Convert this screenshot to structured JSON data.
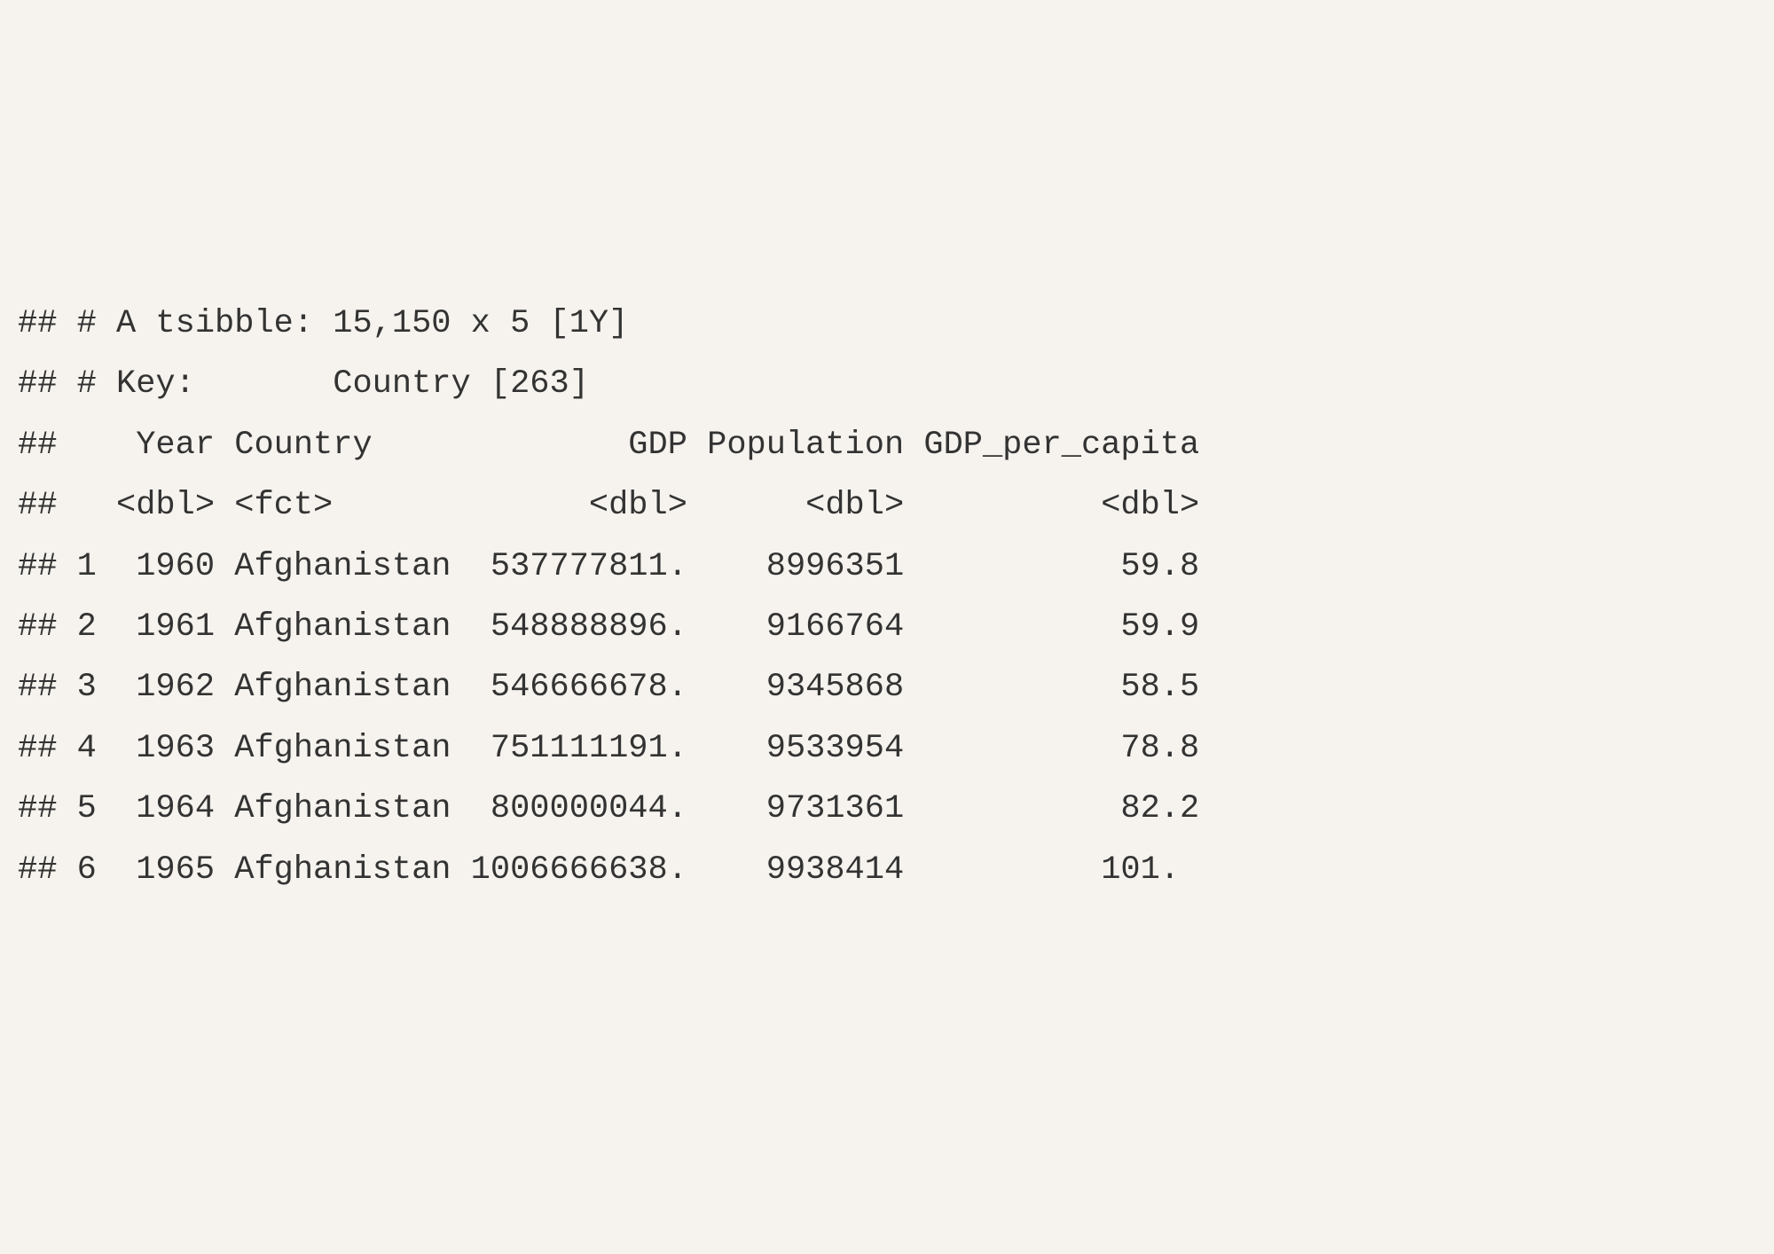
{
  "chart_data": {
    "type": "table",
    "header_meta": {
      "prefix": "##",
      "tsibble_line": "# A tsibble: 15,150 x 5 [1Y]",
      "key_line": "# Key:       Country [263]"
    },
    "columns": [
      {
        "name": "Year",
        "type": "<dbl>"
      },
      {
        "name": "Country",
        "type": "<fct>"
      },
      {
        "name": "GDP",
        "type": "<dbl>"
      },
      {
        "name": "Population",
        "type": "<dbl>"
      },
      {
        "name": "GDP_per_capita",
        "type": "<dbl>"
      }
    ],
    "rows": [
      {
        "n": 1,
        "Year": 1960,
        "Country": "Afghanistan",
        "GDP": "537777811.",
        "Population": "8996351",
        "GDP_per_capita": "59.8"
      },
      {
        "n": 2,
        "Year": 1961,
        "Country": "Afghanistan",
        "GDP": "548888896.",
        "Population": "9166764",
        "GDP_per_capita": "59.9"
      },
      {
        "n": 3,
        "Year": 1962,
        "Country": "Afghanistan",
        "GDP": "546666678.",
        "Population": "9345868",
        "GDP_per_capita": "58.5"
      },
      {
        "n": 4,
        "Year": 1963,
        "Country": "Afghanistan",
        "GDP": "751111191.",
        "Population": "9533954",
        "GDP_per_capita": "78.8"
      },
      {
        "n": 5,
        "Year": 1964,
        "Country": "Afghanistan",
        "GDP": "800000044.",
        "Population": "9731361",
        "GDP_per_capita": "82.2"
      },
      {
        "n": 6,
        "Year": 1965,
        "Country": "Afghanistan",
        "GDP": "1006666638.",
        "Population": "9938414",
        "GDP_per_capita": "101."
      }
    ]
  },
  "lines": {
    "l0": "## # A tsibble: 15,150 x 5 [1Y]",
    "l1": "## # Key:       Country [263]",
    "l2": "##    Year Country             GDP Population GDP_per_capita",
    "l3": "##   <dbl> <fct>             <dbl>      <dbl>          <dbl>",
    "l4": "## 1  1960 Afghanistan  537777811.    8996351           59.8",
    "l5": "## 2  1961 Afghanistan  548888896.    9166764           59.9",
    "l6": "## 3  1962 Afghanistan  546666678.    9345868           58.5",
    "l7": "## 4  1963 Afghanistan  751111191.    9533954           78.8",
    "l8": "## 5  1964 Afghanistan  800000044.    9731361           82.2",
    "l9": "## 6  1965 Afghanistan 1006666638.    9938414          101. "
  }
}
